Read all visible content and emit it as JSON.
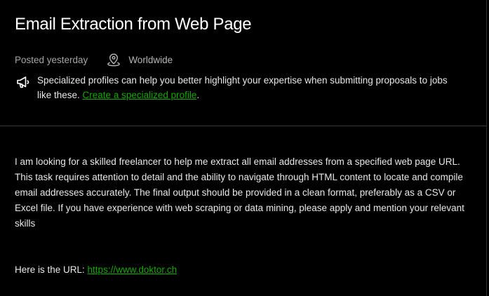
{
  "job": {
    "title": "Email Extraction from Web Page",
    "posted": "Posted yesterday",
    "location": "Worldwide"
  },
  "notice": {
    "icon": "megaphone-icon",
    "text": "Specialized profiles can help you better highlight your expertise when submitting proposals to jobs like these. ",
    "link_label": "Create a specialized profile",
    "suffix": "."
  },
  "description": {
    "body": "I am looking for a skilled freelancer to help me extract all email addresses from a specified web page URL. This task requires attention to detail and the ability to navigate through HTML content to locate and compile email addresses accurately. The final output should be provided in a clean format, preferably as a CSV or Excel file. If you have experience with web scraping or data mining, please apply and mention your relevant skills",
    "url_prefix": "Here is the URL: ",
    "url": "https://www.doktor.ch"
  },
  "colors": {
    "background": "#000000",
    "link": "#14a800",
    "muted_text": "#a5a5a5",
    "body_text": "#e8e8e8"
  }
}
